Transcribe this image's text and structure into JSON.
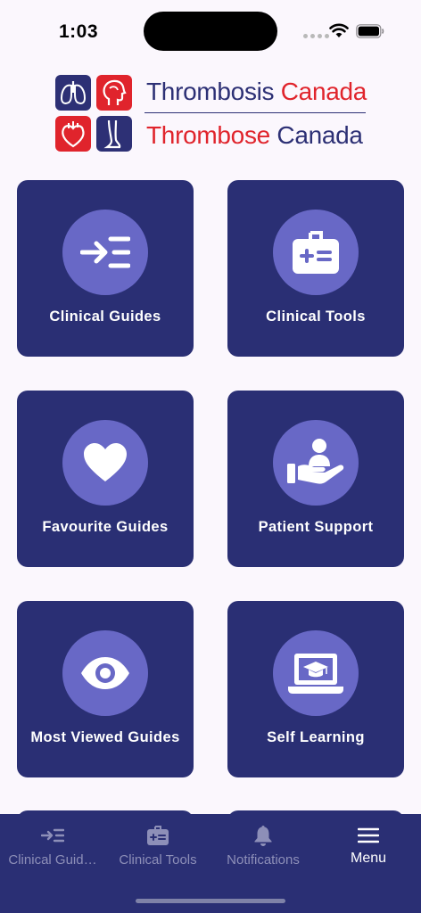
{
  "status_bar": {
    "time": "1:03"
  },
  "logo": {
    "line1_part1": "Thrombosis",
    "line1_part2": " Canada",
    "line2_part1": "Thrombose",
    "line2_part2": " Canada"
  },
  "tiles": [
    {
      "label": "Clinical Guides",
      "icon": "arrow-list-icon"
    },
    {
      "label": "Clinical Tools",
      "icon": "medical-kit-icon"
    },
    {
      "label": "Favourite Guides",
      "icon": "heart-icon"
    },
    {
      "label": "Patient Support",
      "icon": "hand-person-icon"
    },
    {
      "label": "Most Viewed Guides",
      "icon": "eye-icon"
    },
    {
      "label": "Self Learning",
      "icon": "laptop-graduation-icon"
    }
  ],
  "tab_bar": {
    "tabs": [
      {
        "label": "Clinical Guid…",
        "icon": "arrow-list-icon"
      },
      {
        "label": "Clinical Tools",
        "icon": "medical-kit-icon"
      },
      {
        "label": "Notifications",
        "icon": "bell-icon"
      },
      {
        "label": "Menu",
        "icon": "hamburger-menu-icon"
      }
    ],
    "active": "Menu"
  },
  "colors": {
    "tile_bg": "#2a2f74",
    "icon_circle": "#6868c6",
    "brand_blue": "#2d3075",
    "brand_red": "#e0242c",
    "background": "#fbf7fd"
  }
}
